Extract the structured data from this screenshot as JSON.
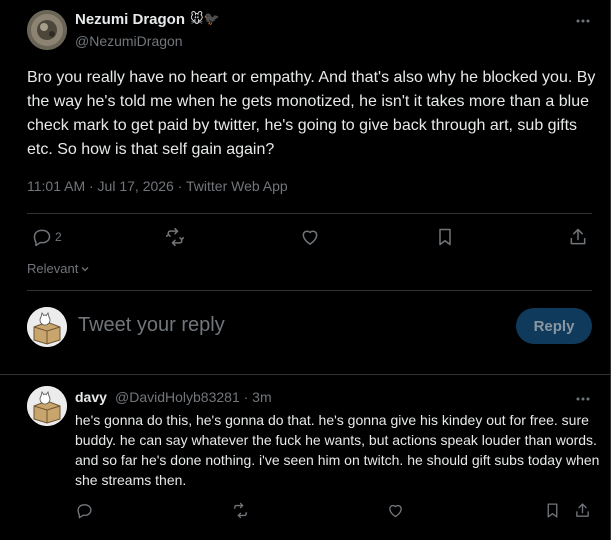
{
  "tweet": {
    "author_name": "Nezumi Dragon",
    "author_emoji": "🐭🐦‍⬛",
    "author_handle": "@NezumiDragon",
    "text": "Bro you really have no heart or empathy. And that's also why he blocked you. By the way he's told me when he gets monotized, he isn't it takes more than a blue check mark to get paid by twitter, he's going to give back through art, sub gifts etc. So how is that self gain again?",
    "meta": "11:01 AM · Jul 17, 2026 · Twitter Web App",
    "reply_count": "2",
    "sort_label": "Relevant"
  },
  "composer": {
    "placeholder": "Tweet your reply",
    "button_label": "Reply"
  },
  "reply": {
    "author_name": "davy",
    "author_handle_time": "@DavidHolyb83281 · 3m",
    "text": "he's gonna do this, he's gonna do that. he's gonna give his kindey out for free. sure buddy. he can say whatever the fuck he wants, but actions speak louder than words.  and so far he's done nothing. i've seen him on twitch. he should gift subs today when she streams then."
  },
  "icons": {
    "reply": "reply-icon",
    "retweet": "retweet-icon",
    "like": "like-icon",
    "bookmark": "bookmark-icon",
    "share": "share-icon",
    "more": "more-icon",
    "chevron": "chevron-down-icon"
  },
  "colors": {
    "background": "#000000",
    "text": "#e7e9ea",
    "muted": "#71767b",
    "divider": "#2f3336",
    "reply_button": "#0f3a5c"
  }
}
